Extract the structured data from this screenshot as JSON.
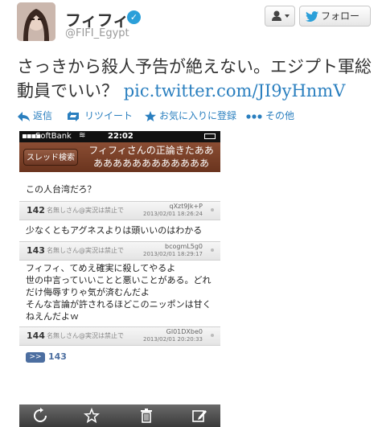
{
  "profile": {
    "display_name": "フィフィ",
    "handle": "@FIFI_Egypt",
    "verified_glyph": "✓",
    "follow_label": "フォロー",
    "user_menu_icon": "user-dropdown-icon",
    "follow_icon": "twitter-bird-icon"
  },
  "tweet": {
    "text": "さっきから殺人予告が絶えない。エジプト軍総動員でいい？ ",
    "link": "pic.twitter.com/JI9yHnmV"
  },
  "actions": {
    "reply": "返信",
    "retweet": "リツイート",
    "favorite": "お気に入りに登録",
    "more": "その他"
  },
  "phone": {
    "status": {
      "carrier": "SoftBank",
      "time": "22:02"
    },
    "nav": {
      "back": "スレッド検索",
      "title_line1": "フィフィさんの正論きたああ",
      "title_line2": "ああああああああああああ"
    },
    "top_text": "この人台湾だろ？",
    "posts": [
      {
        "num": "142",
        "name": "名無しさん@実況は禁止で",
        "id": "qXzt9Jk+P",
        "time": "2013/02/01 18:26:24",
        "lines": [
          "少なくともアグネスよりは頭いいのはわかる"
        ]
      },
      {
        "num": "143",
        "name": "名無しさん@実況は禁止で",
        "id": "bcogmL5g0",
        "time": "2013/02/01 18:29:17",
        "lines": [
          "フィフィ、てめえ確実に殺してやるよ",
          "世の中言っていいことと悪いことがある。どれ",
          "だけ侮辱すりゃ気が済むんだよ",
          "そんな言論が許されるほどこのニッポンは甘く",
          "ねえんだよｗ"
        ]
      },
      {
        "num": "144",
        "name": "名無しさん@実況は禁止で",
        "id": "Gl01DXbe0",
        "time": "2013/02/01 20:20:33",
        "lines": []
      }
    ],
    "reply_badge": ">>",
    "reply_num": "143",
    "toolbar_icons": [
      "refresh-icon",
      "star-icon",
      "trash-icon",
      "compose-icon"
    ]
  },
  "colors": {
    "link": "#2a7fbf",
    "nav": "#7a3f28"
  }
}
